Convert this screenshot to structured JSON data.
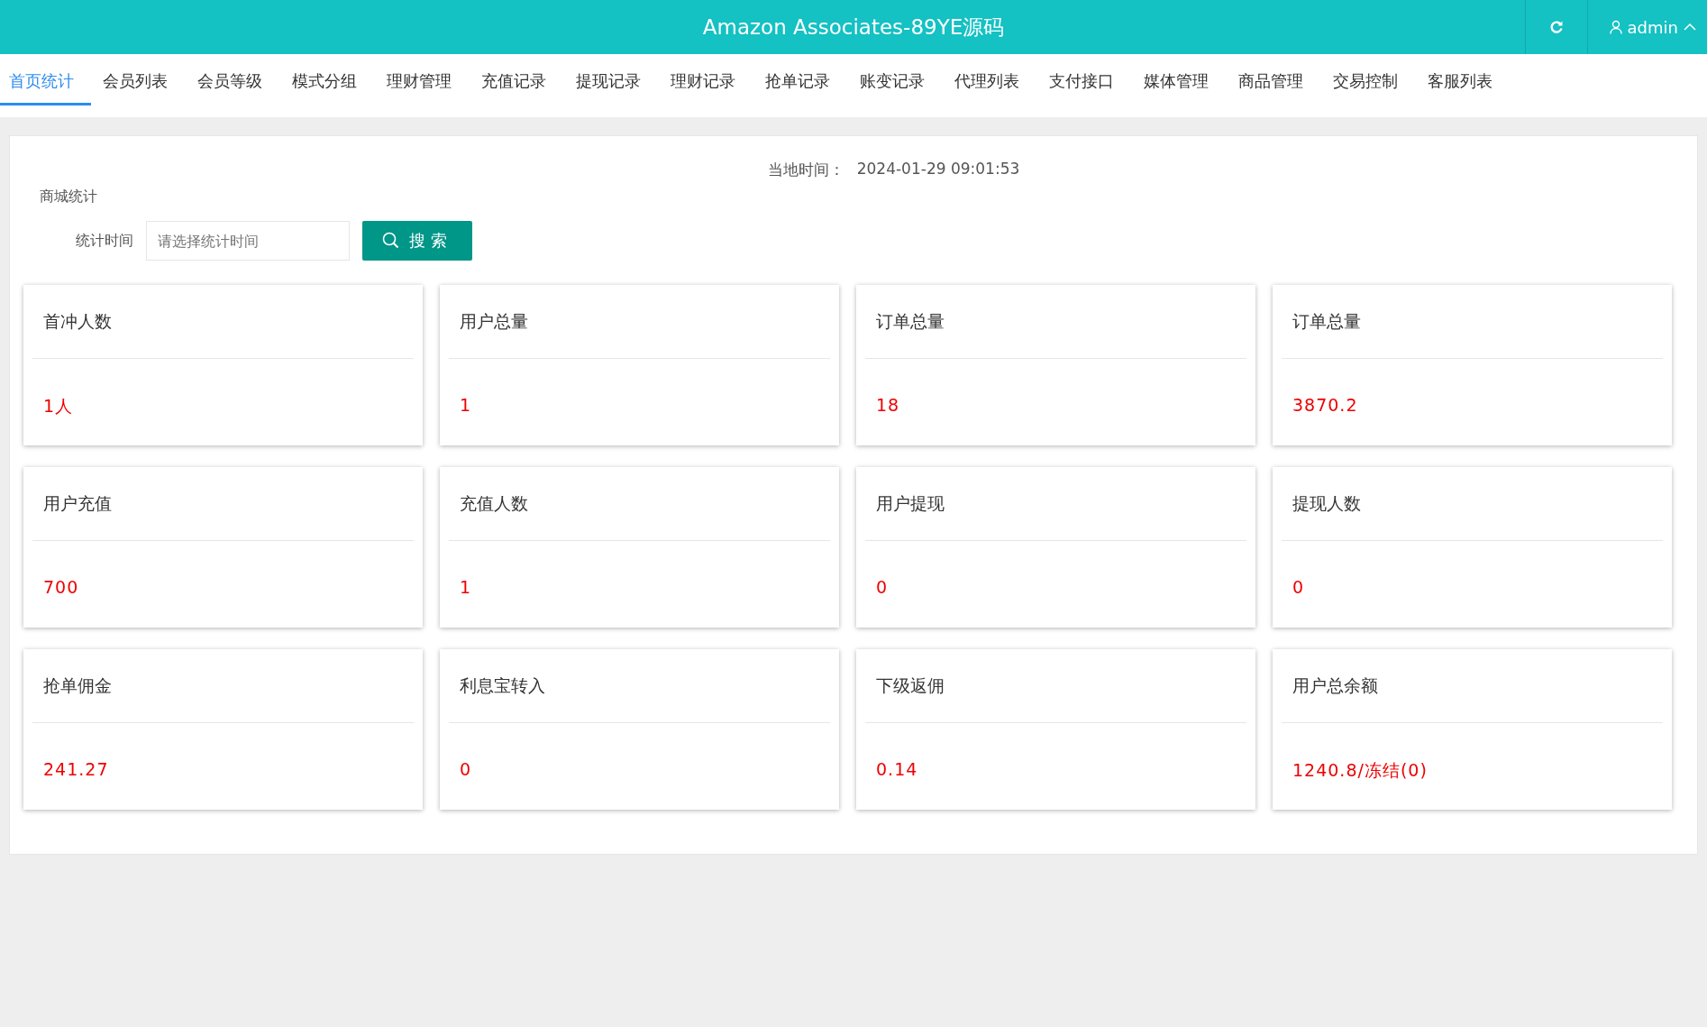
{
  "header": {
    "title": "Amazon Associates-89YE源码",
    "user": "admin"
  },
  "tabs": [
    {
      "label": "首页统计",
      "selected": true
    },
    {
      "label": "会员列表",
      "selected": false
    },
    {
      "label": "会员等级",
      "selected": false
    },
    {
      "label": "模式分组",
      "selected": false
    },
    {
      "label": "理财管理",
      "selected": false
    },
    {
      "label": "充值记录",
      "selected": false
    },
    {
      "label": "提现记录",
      "selected": false
    },
    {
      "label": "理财记录",
      "selected": false
    },
    {
      "label": "抢单记录",
      "selected": false
    },
    {
      "label": "账变记录",
      "selected": false
    },
    {
      "label": "代理列表",
      "selected": false
    },
    {
      "label": "支付接口",
      "selected": false
    },
    {
      "label": "媒体管理",
      "selected": false
    },
    {
      "label": "商品管理",
      "selected": false
    },
    {
      "label": "交易控制",
      "selected": false
    },
    {
      "label": "客服列表",
      "selected": false
    }
  ],
  "local_time": {
    "label": "当地时间：",
    "value": "2024-01-29 09:01:53"
  },
  "section_title": "商城统计",
  "filter": {
    "label": "统计时间",
    "placeholder": "请选择统计时间",
    "button": "搜索"
  },
  "cards": [
    {
      "title": "首冲人数",
      "value": "1人"
    },
    {
      "title": "用户总量",
      "value": "1"
    },
    {
      "title": "订单总量",
      "value": "18"
    },
    {
      "title": "订单总量",
      "value": "3870.2"
    },
    {
      "title": "用户充值",
      "value": "700"
    },
    {
      "title": "充值人数",
      "value": "1"
    },
    {
      "title": "用户提现",
      "value": "0"
    },
    {
      "title": "提现人数",
      "value": "0"
    },
    {
      "title": "抢单佣金",
      "value": "241.27"
    },
    {
      "title": "利息宝转入",
      "value": "0"
    },
    {
      "title": "下级返佣",
      "value": "0.14"
    },
    {
      "title": "用户总余额",
      "value": "1240.8/冻结(0)"
    }
  ]
}
